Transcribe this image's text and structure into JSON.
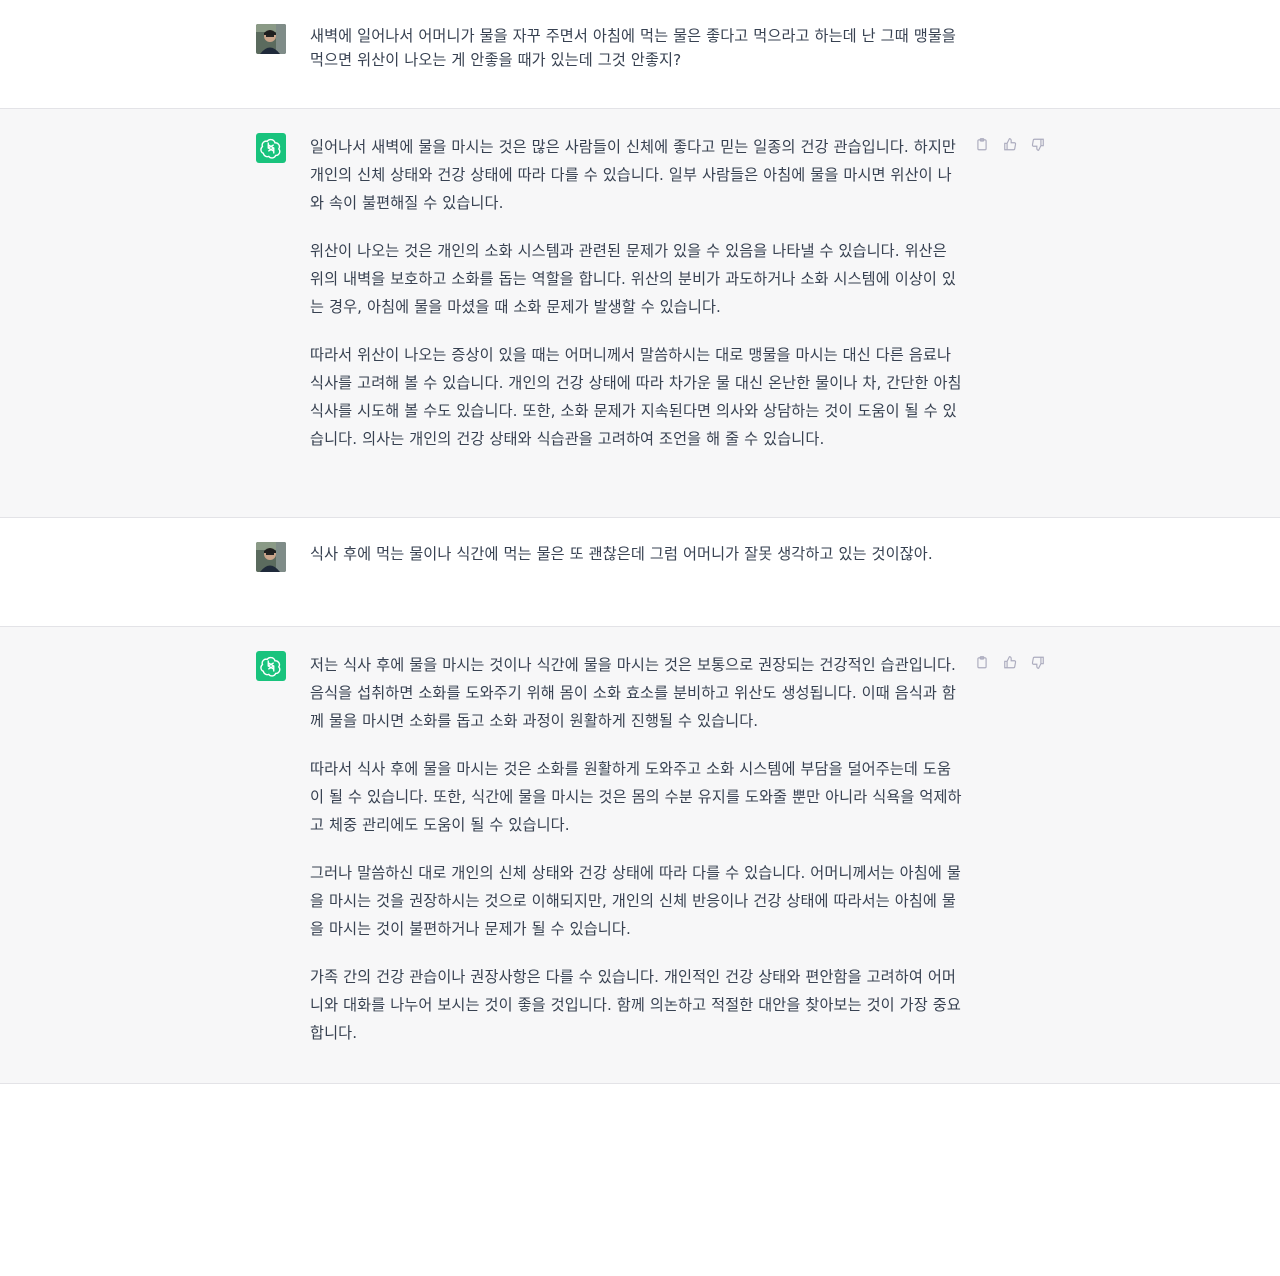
{
  "thread": {
    "messages": [
      {
        "role": "user",
        "paragraphs": [
          "새벽에 일어나서 어머니가 물을 자꾸 주면서 아침에 먹는 물은 좋다고 먹으라고 하는데 난 그때 맹물을 먹으면 위산이 나오는 게 안좋을 때가 있는데 그것 안좋지?"
        ]
      },
      {
        "role": "assistant",
        "paragraphs": [
          "일어나서 새벽에 물을 마시는 것은 많은 사람들이 신체에 좋다고 믿는 일종의 건강 관습입니다. 하지만 개인의 신체 상태와 건강 상태에 따라 다를 수 있습니다. 일부 사람들은 아침에 물을 마시면 위산이 나와 속이 불편해질 수 있습니다.",
          "위산이 나오는 것은 개인의 소화 시스템과 관련된 문제가 있을 수 있음을 나타낼 수 있습니다. 위산은 위의 내벽을 보호하고 소화를 돕는 역할을 합니다. 위산의 분비가 과도하거나 소화 시스템에 이상이 있는 경우, 아침에 물을 마셨을 때 소화 문제가 발생할 수 있습니다.",
          "따라서 위산이 나오는 증상이 있을 때는 어머니께서 말씀하시는 대로 맹물을 마시는 대신 다른 음료나 식사를 고려해 볼 수 있습니다. 개인의 건강 상태에 따라 차가운 물 대신 온난한 물이나 차, 간단한 아침 식사를 시도해 볼 수도 있습니다. 또한, 소화 문제가 지속된다면 의사와 상담하는 것이 도움이 될 수 있습니다. 의사는 개인의 건강 상태와 식습관을 고려하여 조언을 해 줄 수 있습니다."
        ]
      },
      {
        "role": "user",
        "paragraphs": [
          "식사 후에 먹는 물이나 식간에 먹는 물은 또 괜찮은데 그럼 어머니가 잘못 생각하고 있는 것이잖아."
        ]
      },
      {
        "role": "assistant",
        "paragraphs": [
          "저는 식사 후에 물을 마시는 것이나 식간에 물을 마시는 것은 보통으로 권장되는 건강적인 습관입니다. 음식을 섭취하면 소화를 도와주기 위해 몸이 소화 효소를 분비하고 위산도 생성됩니다. 이때 음식과 함께 물을 마시면 소화를 돕고 소화 과정이 원활하게 진행될 수 있습니다.",
          "따라서 식사 후에 물을 마시는 것은 소화를 원활하게 도와주고 소화 시스템에 부담을 덜어주는데 도움이 될 수 있습니다. 또한, 식간에 물을 마시는 것은 몸의 수분 유지를 도와줄 뿐만 아니라 식욕을 억제하고 체중 관리에도 도움이 될 수 있습니다.",
          "그러나 말씀하신 대로 개인의 신체 상태와 건강 상태에 따라 다를 수 있습니다. 어머니께서는 아침에 물을 마시는 것을 권장하시는 것으로 이해되지만, 개인의 신체 반응이나 건강 상태에 따라서는 아침에 물을 마시는 것이 불편하거나 문제가 될 수 있습니다.",
          "가족 간의 건강 관습이나 권장사항은 다를 수 있습니다. 개인적인 건강 상태와 편안함을 고려하여 어머니와 대화를 나누어 보시는 것이 좋을 것입니다. 함께 의논하고 적절한 대안을 찾아보는 것이 가장 중요합니다."
        ]
      }
    ]
  },
  "icons": {
    "copy": "clipboard-icon",
    "like": "thumbs-up-icon",
    "dislike": "thumbs-down-icon",
    "bot": "openai-logo-icon",
    "user": "user-avatar-photo"
  },
  "colors": {
    "assistant_bg": "#f7f7f8",
    "user_bg": "#ffffff",
    "bot_avatar": "#19c37d",
    "text": "#374151",
    "icon": "#acacbe"
  }
}
